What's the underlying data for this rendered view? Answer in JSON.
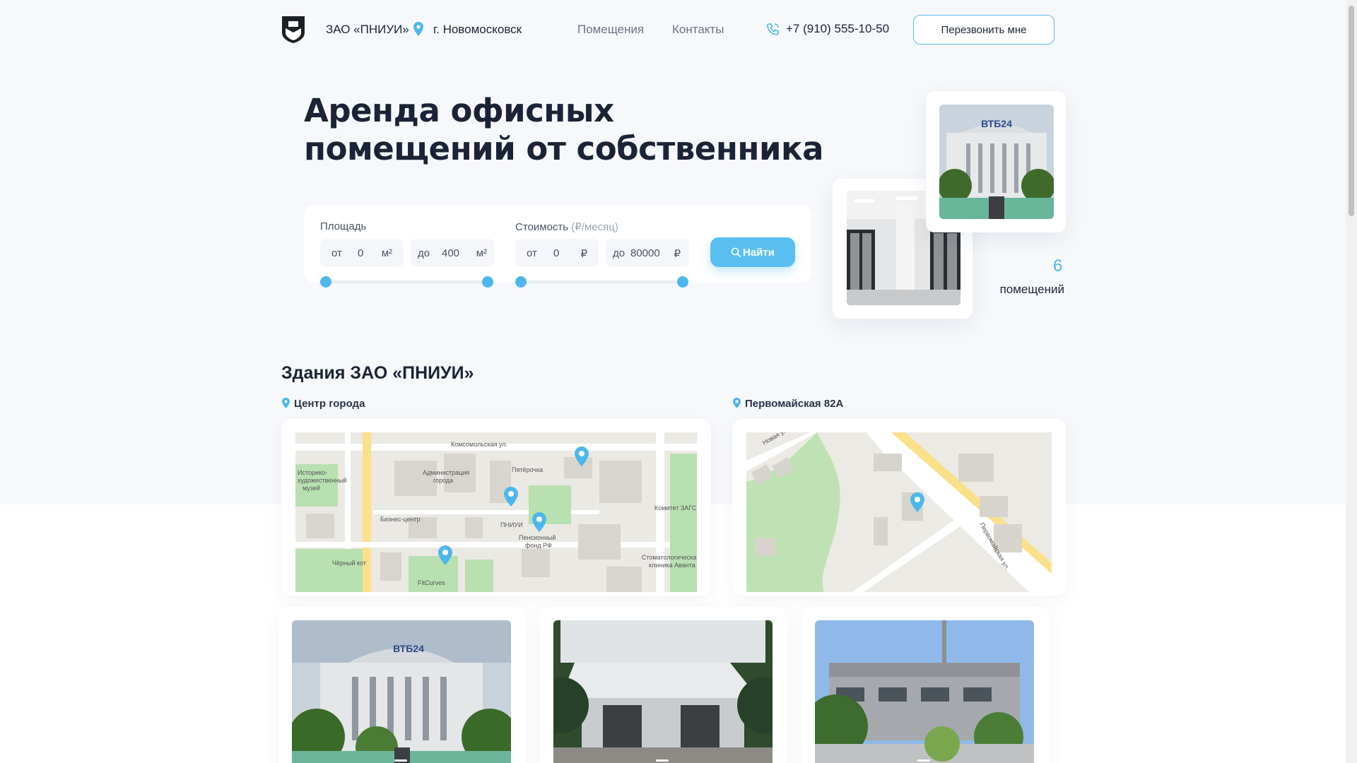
{
  "header": {
    "company": "ЗАО «ПНИУИ»",
    "city": "г. Новомосковск",
    "nav": [
      "Помещения",
      "Контакты"
    ],
    "phone": "+7 (910) 555-10-50",
    "callback_label": "Перезвонить мне"
  },
  "hero": {
    "title_line1": "Аренда офисных",
    "title_line2": "помещений от собственника"
  },
  "filters": {
    "area": {
      "label": "Площадь",
      "from_prefix": "от",
      "from_value": "0",
      "from_unit": "м²",
      "to_prefix": "до",
      "to_value": "400",
      "to_unit": "м²"
    },
    "price": {
      "label": "Стоимость",
      "unit_note": "(₽/месяц)",
      "from_prefix": "от",
      "from_value": "0",
      "from_unit": "₽",
      "to_prefix": "до",
      "to_value": "80000",
      "to_unit": "₽"
    },
    "find_label": "Найти"
  },
  "stats": {
    "count": "6",
    "count_label": "помещений"
  },
  "buildings": {
    "section_title": "Здания ЗАО «ПНИУИ»",
    "locations": [
      "Центр города",
      "Первомайская 82А"
    ],
    "map1_labels": [
      "Комсомольская ул.",
      "Историко-",
      "художественный",
      "музей",
      "Администрация",
      "города",
      "Пятёрочка",
      "Бизнес-центр",
      "ПНИУИ",
      "Пенсионный",
      "фонд РФ",
      "Комитет ЗАГС",
      "Стоматологическая",
      "клиника Аванта",
      "Чёрный кот",
      "FitCurves"
    ],
    "map2_labels": [
      "Новая ул.",
      "Первомайская ул."
    ],
    "photo_brand": "ВТБ24"
  },
  "colors": {
    "accent": "#59bff0",
    "pin": "#4cb7ec",
    "text": "#1b2436",
    "muted": "#6b7485",
    "bg": "#f6f8fb"
  },
  "icons": [
    "shield-logo-icon",
    "location-pin-icon",
    "phone-icon",
    "search-icon",
    "map-marker-icon"
  ]
}
